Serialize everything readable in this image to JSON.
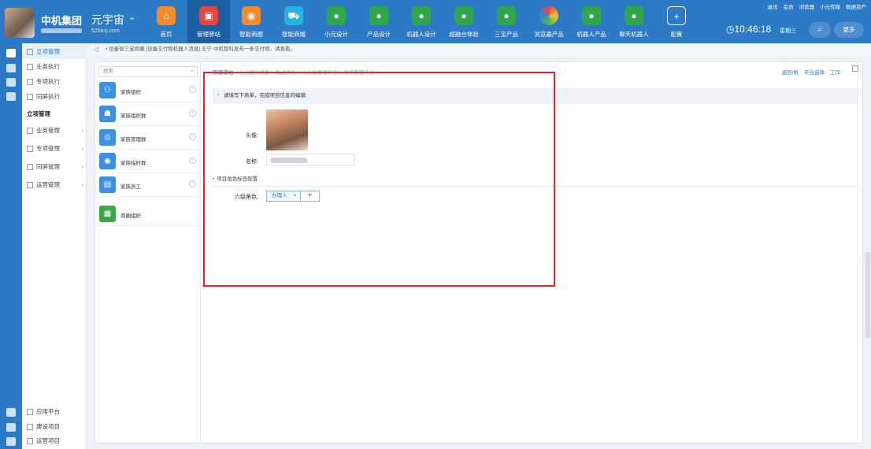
{
  "brand": {
    "name": "中机集团",
    "org": "元宇宙",
    "url": "520ezj.com"
  },
  "nav": [
    {
      "label": "首页",
      "icon": "home-icon",
      "color": "orange",
      "glyph": "⌂"
    },
    {
      "label": "管理驿站",
      "icon": "station-icon",
      "color": "red",
      "glyph": "▣",
      "active": true
    },
    {
      "label": "智能商圈",
      "icon": "shop-circle-icon",
      "color": "orange",
      "glyph": "◉"
    },
    {
      "label": "智能商城",
      "icon": "cart-icon",
      "color": "cyan",
      "glyph": "⛟"
    },
    {
      "label": "小元设计",
      "icon": "robot-icon",
      "color": "green",
      "glyph": "●"
    },
    {
      "label": "产品设计",
      "icon": "robot-icon",
      "color": "green",
      "glyph": "●"
    },
    {
      "label": "机器人设计",
      "icon": "robot-icon",
      "color": "green",
      "glyph": "●"
    },
    {
      "label": "超融合体验",
      "icon": "robot-icon",
      "color": "green",
      "glyph": "●"
    },
    {
      "label": "三宝产品",
      "icon": "robot-icon",
      "color": "green",
      "glyph": "●"
    },
    {
      "label": "浏览器产品",
      "icon": "browser-icon",
      "color": "rainbow",
      "glyph": ""
    },
    {
      "label": "机器人产品",
      "icon": "robot-icon",
      "color": "green",
      "glyph": "●"
    },
    {
      "label": "聊天机器人",
      "icon": "robot-icon",
      "color": "green",
      "glyph": "●"
    },
    {
      "label": "配置",
      "icon": "plus-icon",
      "color": "plus",
      "glyph": "+"
    }
  ],
  "top_links": [
    "退出",
    "会员",
    "浏览器",
    "小元传媒",
    "数据资产"
  ],
  "clock": {
    "time": "10:46:18",
    "weekday": "星期三"
  },
  "more_label": "更多",
  "sidebar": {
    "items": [
      {
        "label": "立项管理",
        "active": true
      },
      {
        "label": "业务执行"
      },
      {
        "label": "专项执行"
      },
      {
        "label": "同屏执行"
      },
      {
        "label": "立项管理",
        "header": true
      },
      {
        "label": "业务管理",
        "chev": true
      },
      {
        "label": "专项管理",
        "chev": true
      },
      {
        "label": "同屏管理",
        "chev": true
      },
      {
        "label": "运营管理",
        "chev": true
      }
    ],
    "bottom": [
      {
        "label": "应用平台"
      },
      {
        "label": "建设项目"
      },
      {
        "label": "运营项目"
      }
    ]
  },
  "notice": "• 设备智三宝商圈 [设备交付物机器人消息] 王宁·中机智科发布一条交付物，请查看。",
  "tree": {
    "search_placeholder": "搜索",
    "items": [
      {
        "label": "家族组织",
        "color": "#3d8fe0",
        "glyph": "⚇"
      },
      {
        "label": "家族组织群",
        "color": "#3d8fe0",
        "glyph": "☗"
      },
      {
        "label": "家族管理群",
        "color": "#3d8fe0",
        "glyph": "◎"
      },
      {
        "label": "家族临时群",
        "color": "#3d8fe0",
        "glyph": "◉"
      },
      {
        "label": "家族员工",
        "color": "#3d8fe0",
        "glyph": "▤"
      },
      {
        "label": "商圈组织",
        "color": "#3aa845",
        "glyph": "▦"
      }
    ]
  },
  "content": {
    "breadcrumb_first": "管理驿站",
    "breadcrumb_rest": "> 三元组织商品 > 概述商品 > 小元能管理平台 > 专项管理平台 >",
    "actions": [
      "返回/帆",
      "平台选择",
      "工作"
    ],
    "banner": "请填写下表单，完成项目信息的编辑:",
    "avatar_label": "头像:",
    "name_label": "名称:",
    "section_title": "项目角色标签配置",
    "role_label": "六级角色:",
    "role_tag": "办理人",
    "add_label": "+"
  }
}
